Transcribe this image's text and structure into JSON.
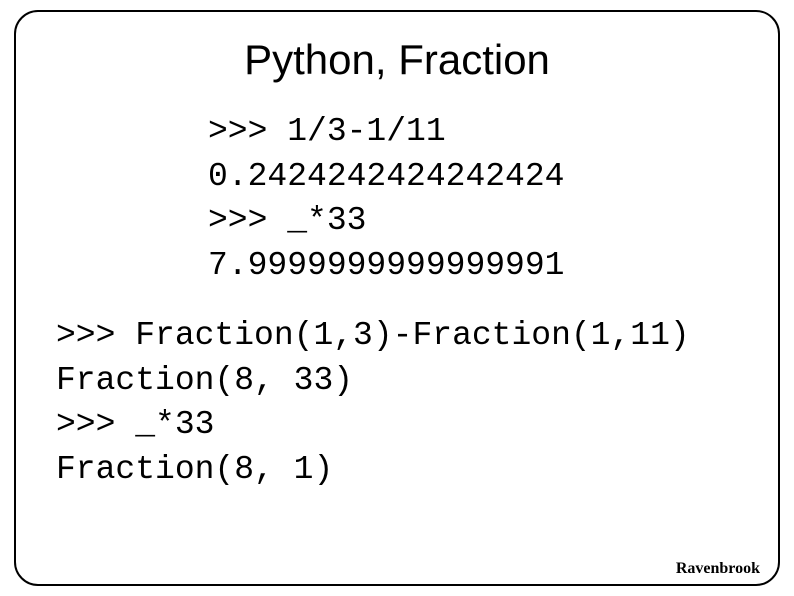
{
  "title": "Python, Fraction",
  "block1": {
    "lines": [
      ">>> 1/3-1/11",
      "0.2424242424242424",
      ">>> _*33",
      "7.9999999999999991"
    ]
  },
  "block2": {
    "lines": [
      ">>> Fraction(1,3)-Fraction(1,11)",
      "Fraction(8, 33)",
      ">>> _*33",
      "Fraction(8, 1)"
    ]
  },
  "footer": "Ravenbrook"
}
